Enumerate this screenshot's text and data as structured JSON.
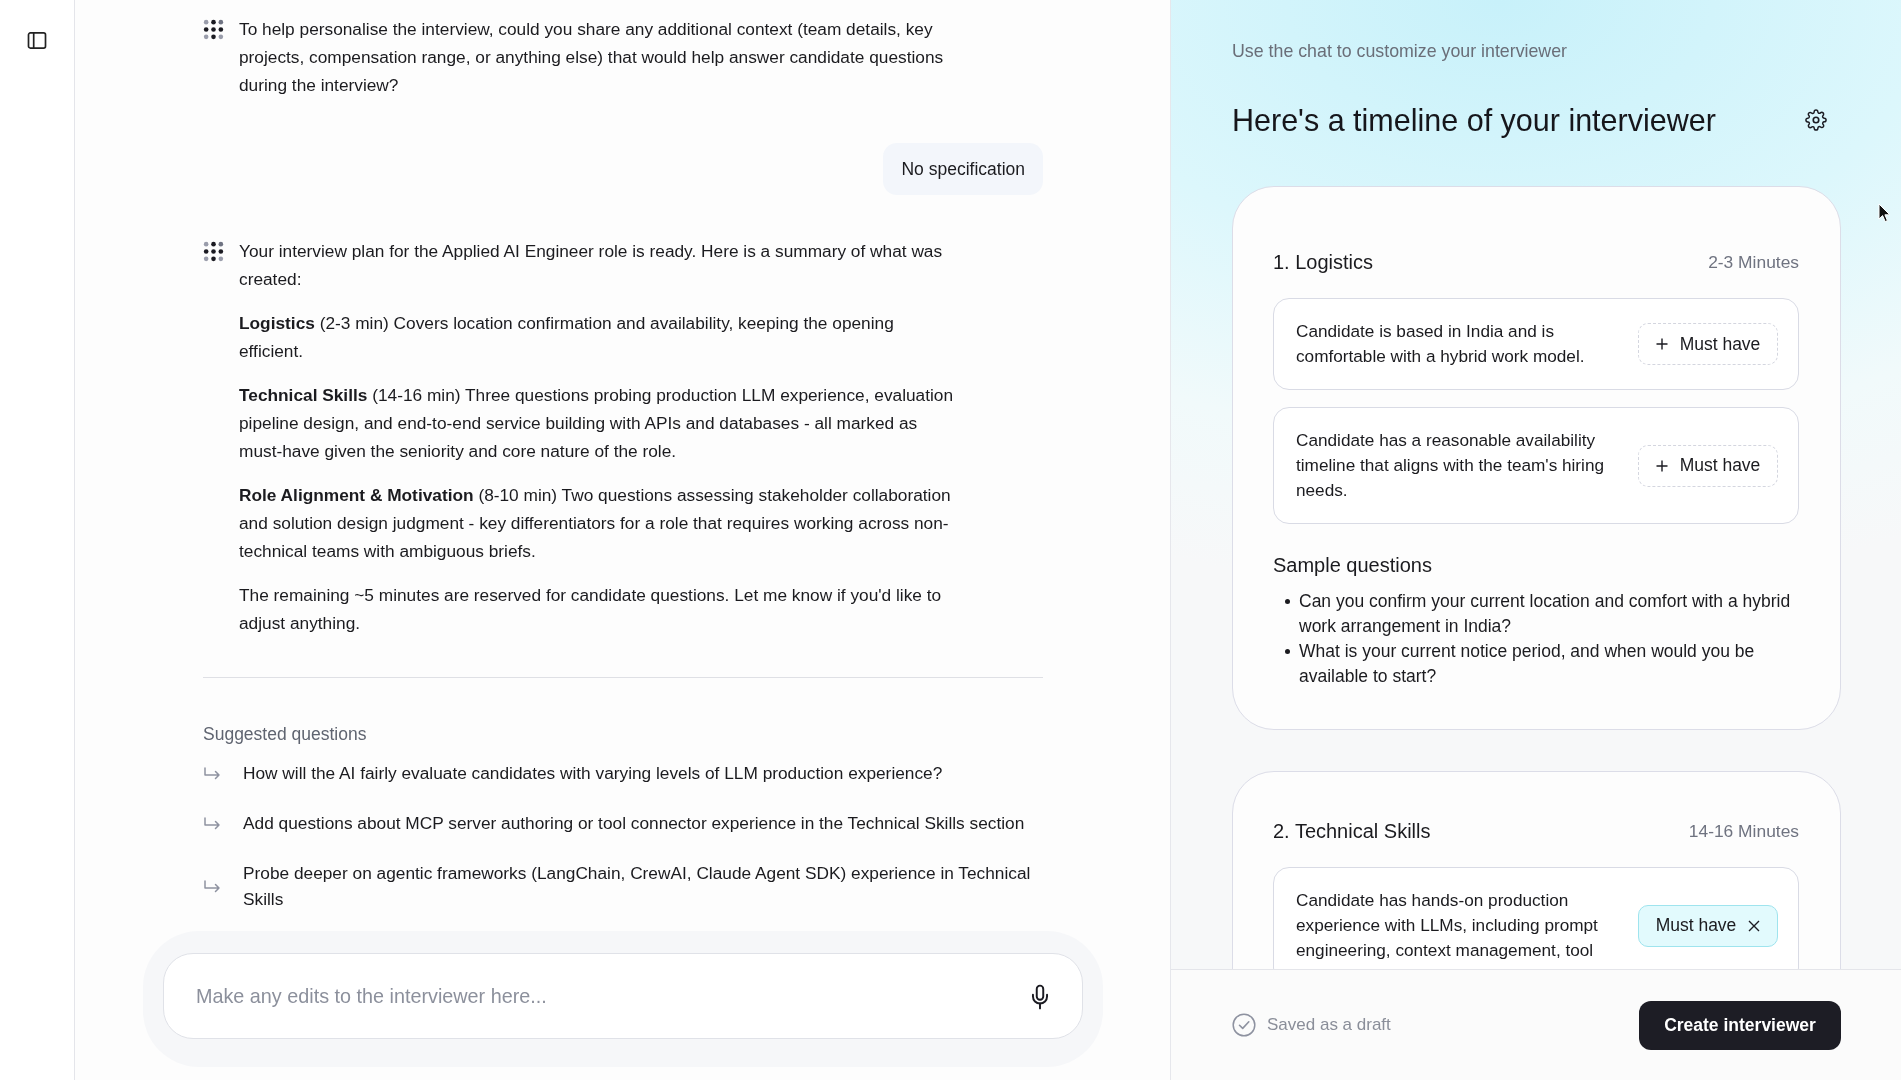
{
  "chat": {
    "messages": [
      {
        "kind": "assistant",
        "paragraphs": [
          "To help personalise the interview, could you share any additional context (team details, key projects, compensation range, or anything else) that would help answer candidate questions during the interview?"
        ]
      },
      {
        "kind": "user",
        "text": "No specification"
      },
      {
        "kind": "assistant",
        "paragraphs": [
          "Your interview plan for the Applied AI Engineer role is ready. Here is a summary of what was created:",
          "**Logistics** (2-3 min) Covers location confirmation and availability, keeping the opening efficient.",
          "**Technical Skills** (14-16 min) Three questions probing production LLM experience, evaluation pipeline design, and end-to-end service building with APIs and databases - all marked as must-have given the seniority and core nature of the role.",
          "**Role Alignment & Motivation** (8-10 min) Two questions assessing stakeholder collaboration and solution design judgment - key differentiators for a role that requires working across non-technical teams with ambiguous briefs.",
          "The remaining ~5 minutes are reserved for candidate questions. Let me know if you'd like to adjust anything."
        ]
      }
    ],
    "suggested": {
      "title": "Suggested questions",
      "items": [
        "How will the AI fairly evaluate candidates with varying levels of LLM production experience?",
        "Add questions about MCP server authoring or tool connector experience in the Technical Skills section",
        "Probe deeper on agentic frameworks (LangChain, CrewAI, Claude Agent SDK) experience in Technical Skills"
      ]
    },
    "composer": {
      "placeholder": "Make any edits to the interviewer here..."
    }
  },
  "panel": {
    "hint": "Use the chat to customize your interviewer",
    "title": "Here's a timeline of your interviewer",
    "sections": [
      {
        "title": "1. Logistics",
        "duration": "2-3 Minutes",
        "criteria": [
          {
            "text": "Candidate is based in India and is comfortable with a hybrid work model.",
            "label": "Must have",
            "must_have": false
          },
          {
            "text": "Candidate has a reasonable availability timeline that aligns with the team's hiring needs.",
            "label": "Must have",
            "must_have": false
          }
        ],
        "sample_title": "Sample questions",
        "samples": [
          "Can you confirm your current location and comfort with a hybrid work arrangement in India?",
          "What is your current notice period, and when would you be available to start?"
        ]
      },
      {
        "title": "2. Technical Skills",
        "duration": "14-16 Minutes",
        "criteria": [
          {
            "text": "Candidate has hands-on production experience with LLMs, including prompt engineering, context management, tool",
            "label": "Must have",
            "must_have": true
          }
        ]
      }
    ],
    "footer": {
      "status": "Saved as a draft",
      "button": "Create interviewer"
    }
  }
}
